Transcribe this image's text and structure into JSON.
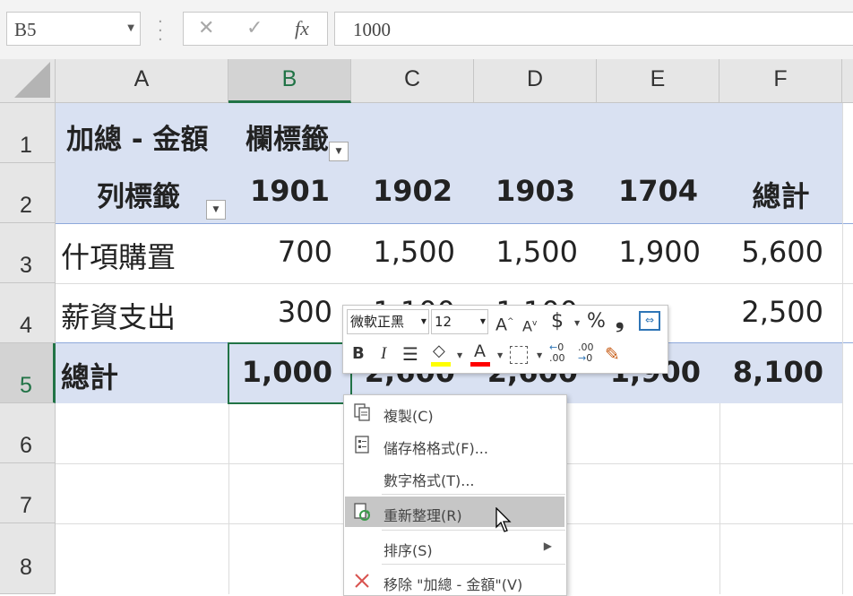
{
  "formula_bar": {
    "name_box": "B5",
    "cancel_glyph": "✕",
    "enter_glyph": "✓",
    "fx_label": "fx",
    "formula_value": "1000"
  },
  "columns": [
    "A",
    "B",
    "C",
    "D",
    "E",
    "F"
  ],
  "selected_column": "B",
  "rows": [
    "1",
    "2",
    "3",
    "4",
    "5",
    "6",
    "7",
    "8"
  ],
  "selected_row": "5",
  "pivot": {
    "values_label": "加總 - 金額",
    "column_labels_header": "欄標籤",
    "row_labels_header": "列標籤",
    "column_keys": [
      "1901",
      "1902",
      "1903",
      "1704"
    ],
    "grand_total_col": "總計",
    "rows": [
      {
        "label": "什項購置",
        "values": [
          "700",
          "1,500",
          "1,500",
          "1,900"
        ],
        "total": "5,600"
      },
      {
        "label": "薪資支出",
        "values": [
          "300",
          "1,100",
          "1,100",
          ""
        ],
        "total": "2,500"
      },
      {
        "label": "總計",
        "values": [
          "1,000",
          "2,600",
          "2,600",
          "1,900"
        ],
        "total": "8,100"
      }
    ]
  },
  "mini_toolbar": {
    "font_name": "微軟正黑",
    "font_size": "12",
    "grow_font": "A",
    "shrink_font": "A",
    "currency": "$",
    "percent": "%",
    "comma": "❟",
    "bold": "B",
    "italic": "I",
    "font_color_letter": "A",
    "increase_decimal": ".00",
    "decrease_decimal": ".00",
    "colors": {
      "highlight": "#ffff00",
      "font_color": "#ff0000"
    }
  },
  "context_menu": {
    "items": [
      {
        "label": "複製(C)",
        "icon": "copy-icon"
      },
      {
        "label": "儲存格格式(F)...",
        "icon": "format-cells-icon"
      },
      {
        "label": "數字格式(T)...",
        "icon": ""
      },
      {
        "label": "重新整理(R)",
        "icon": "refresh-icon",
        "highlighted": true
      },
      {
        "label": "排序(S)",
        "icon": "",
        "submenu": true
      },
      {
        "label": "移除 \"加總 - 金額\"(V)",
        "icon": "remove-x-icon"
      }
    ]
  },
  "colors": {
    "pivot_band": "#d9e1f2",
    "excel_green": "#217346",
    "menu_highlight": "#c6c6c6"
  }
}
